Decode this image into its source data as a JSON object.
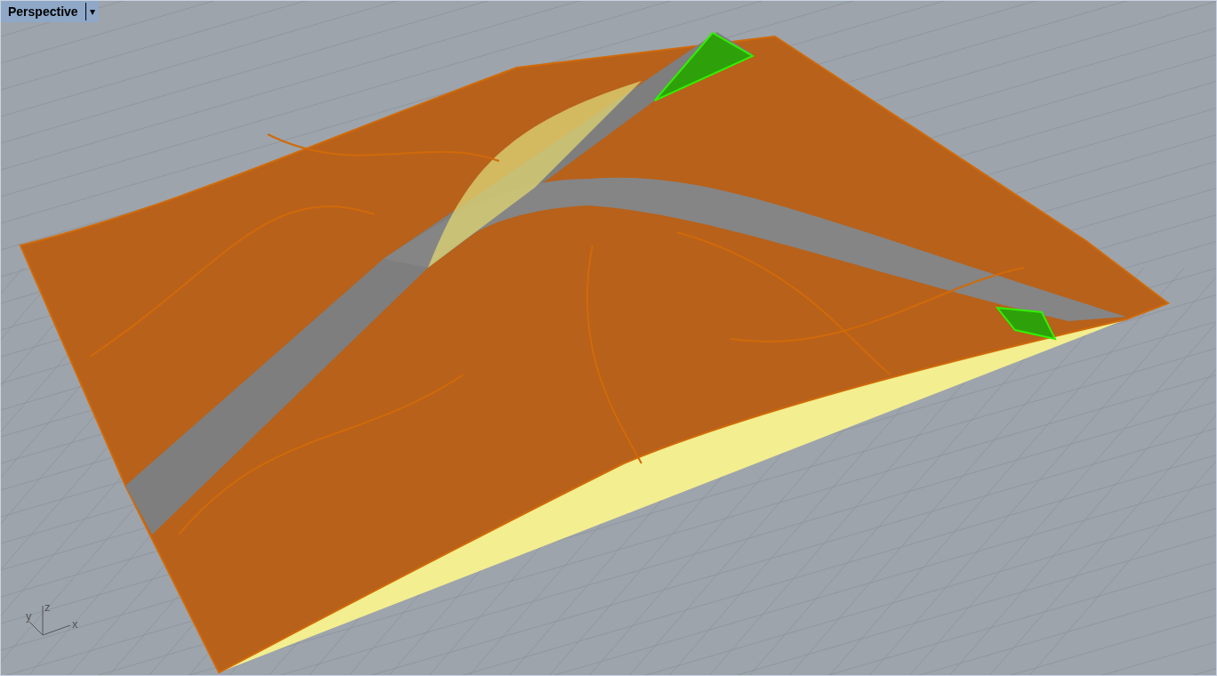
{
  "viewport": {
    "title": "Perspective",
    "menu_arrow": "▾",
    "axes": [
      "y",
      "z",
      "x"
    ]
  }
}
